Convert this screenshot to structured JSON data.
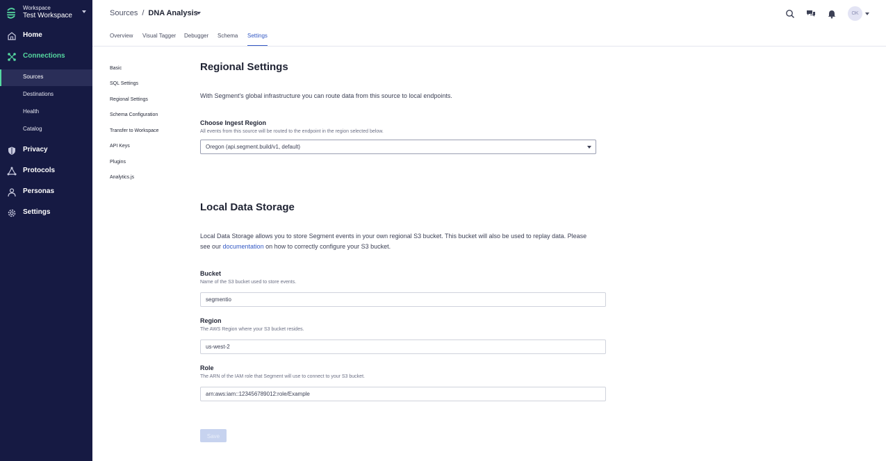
{
  "workspace": {
    "label": "Workspace",
    "name": "Test Workspace"
  },
  "nav": {
    "home": "Home",
    "connections": "Connections",
    "sub": [
      "Sources",
      "Destinations",
      "Health",
      "Catalog"
    ],
    "privacy": "Privacy",
    "protocols": "Protocols",
    "personas": "Personas",
    "settings": "Settings"
  },
  "header": {
    "breadcrumb_root": "Sources",
    "breadcrumb_sep": "/",
    "breadcrumb_current": "DNA Analysis",
    "avatar_initials": "OK"
  },
  "tabs": [
    "Overview",
    "Visual Tagger",
    "Debugger",
    "Schema",
    "Settings"
  ],
  "settings_nav": [
    "Basic",
    "SQL Settings",
    "Regional Settings",
    "Schema Configuration",
    "Transfer to Workspace",
    "API Keys",
    "Plugins",
    "Analytics.js"
  ],
  "regional": {
    "title": "Regional Settings",
    "description": "With Segment's global infrastructure you can route data from this source to local endpoints.",
    "ingest_label": "Choose Ingest Region",
    "ingest_help": "All events from this source will be routed to the endpoint in the region selected below.",
    "ingest_value": "Oregon (api.segment.build/v1, default)"
  },
  "storage": {
    "title": "Local Data Storage",
    "desc_before": "Local Data Storage allows you to store Segment events in your own regional S3 bucket. This bucket will also be used to replay data. Please see our ",
    "desc_link": "documentation",
    "desc_after": " on how to correctly configure your S3 bucket.",
    "bucket_label": "Bucket",
    "bucket_help": "Name of the S3 bucket used to store events.",
    "bucket_value": "segmentio",
    "region_label": "Region",
    "region_help": "The AWS Region where your S3 bucket resides.",
    "region_value": "us-west-2",
    "role_label": "Role",
    "role_help": "The ARN of the IAM role that Segment will use to connect to your S3 bucket.",
    "role_value": "arn:aws:iam::123456789012:role/Example",
    "save_label": "Save"
  },
  "colors": {
    "sidebar": "#161a43",
    "accent_green": "#55d8a0",
    "link_blue": "#3258c4"
  }
}
